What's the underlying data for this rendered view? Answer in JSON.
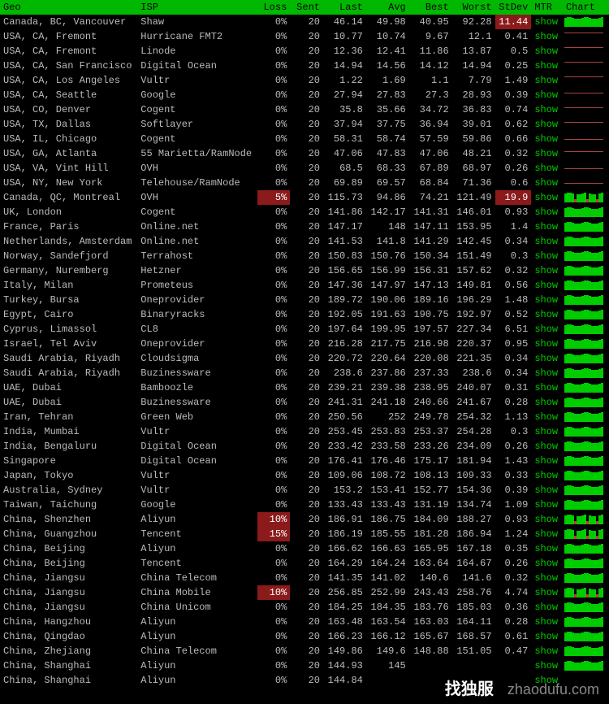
{
  "headers": {
    "geo": "Geo",
    "isp": "ISP",
    "loss": "Loss",
    "sent": "Sent",
    "last": "Last",
    "avg": "Avg",
    "best": "Best",
    "worst": "Worst",
    "stdev": "StDev",
    "mtr": "MTR",
    "chart": "Chart"
  },
  "mtr_label": "show",
  "rows": [
    {
      "geo": "Canada, BC, Vancouver",
      "isp": "Shaw",
      "loss": "0%",
      "sent": "20",
      "last": "46.14",
      "avg": "49.98",
      "best": "40.95",
      "worst": "92.28",
      "stdev": "11.44",
      "stdev_warn": true,
      "chart": "bars"
    },
    {
      "geo": "USA, CA, Fremont",
      "isp": "Hurricane FMT2",
      "loss": "0%",
      "sent": "20",
      "last": "10.77",
      "avg": "10.74",
      "best": "9.67",
      "worst": "12.1",
      "stdev": "0.41",
      "chart": "line-top"
    },
    {
      "geo": "USA, CA, Fremont",
      "isp": "Linode",
      "loss": "0%",
      "sent": "20",
      "last": "12.36",
      "avg": "12.41",
      "best": "11.86",
      "worst": "13.87",
      "stdev": "0.5",
      "chart": "line-top"
    },
    {
      "geo": "USA, CA, San Francisco",
      "isp": "Digital Ocean",
      "loss": "0%",
      "sent": "20",
      "last": "14.94",
      "avg": "14.56",
      "best": "14.12",
      "worst": "14.94",
      "stdev": "0.25",
      "chart": "line-top"
    },
    {
      "geo": "USA, CA, Los Angeles",
      "isp": "Vultr",
      "loss": "0%",
      "sent": "20",
      "last": "1.22",
      "avg": "1.69",
      "best": "1.1",
      "worst": "7.79",
      "stdev": "1.49",
      "chart": "line-top"
    },
    {
      "geo": "USA, CA, Seattle",
      "isp": "Google",
      "loss": "0%",
      "sent": "20",
      "last": "27.94",
      "avg": "27.83",
      "best": "27.3",
      "worst": "28.93",
      "stdev": "0.39",
      "chart": "line-upper"
    },
    {
      "geo": "USA, CO, Denver",
      "isp": "Cogent",
      "loss": "0%",
      "sent": "20",
      "last": "35.8",
      "avg": "35.66",
      "best": "34.72",
      "worst": "36.83",
      "stdev": "0.74",
      "chart": "line-upper"
    },
    {
      "geo": "USA, TX, Dallas",
      "isp": "Softlayer",
      "loss": "0%",
      "sent": "20",
      "last": "37.94",
      "avg": "37.75",
      "best": "36.94",
      "worst": "39.01",
      "stdev": "0.62",
      "chart": "line-upper"
    },
    {
      "geo": "USA, IL, Chicago",
      "isp": "Cogent",
      "loss": "0%",
      "sent": "20",
      "last": "58.31",
      "avg": "58.74",
      "best": "57.59",
      "worst": "59.86",
      "stdev": "0.66",
      "chart": "line-mid"
    },
    {
      "geo": "USA, GA, Atlanta",
      "isp": "55 Marietta/RamNode",
      "loss": "0%",
      "sent": "20",
      "last": "47.06",
      "avg": "47.83",
      "best": "47.06",
      "worst": "48.21",
      "stdev": "0.32",
      "chart": "line-upper"
    },
    {
      "geo": "USA, VA, Vint Hill",
      "isp": "OVH",
      "loss": "0%",
      "sent": "20",
      "last": "68.5",
      "avg": "68.33",
      "best": "67.89",
      "worst": "68.97",
      "stdev": "0.26",
      "chart": "line-mid"
    },
    {
      "geo": "USA, NY, New York",
      "isp": "Telehouse/RamNode",
      "loss": "0%",
      "sent": "20",
      "last": "69.89",
      "avg": "69.57",
      "best": "68.84",
      "worst": "71.36",
      "stdev": "0.6",
      "chart": "line-mid"
    },
    {
      "geo": "Canada, QC, Montreal",
      "isp": "OVH",
      "loss": "5%",
      "loss_warn": true,
      "sent": "20",
      "last": "115.73",
      "avg": "94.86",
      "best": "74.21",
      "worst": "121.49",
      "stdev": "19.9",
      "stdev_warn": true,
      "chart": "bars-loss"
    },
    {
      "geo": "UK, London",
      "isp": "Cogent",
      "loss": "0%",
      "sent": "20",
      "last": "141.86",
      "avg": "142.17",
      "best": "141.31",
      "worst": "146.01",
      "stdev": "0.93",
      "chart": "bars"
    },
    {
      "geo": "France, Paris",
      "isp": "Online.net",
      "loss": "0%",
      "sent": "20",
      "last": "147.17",
      "avg": "148",
      "best": "147.11",
      "worst": "153.95",
      "stdev": "1.4",
      "chart": "bars"
    },
    {
      "geo": "Netherlands, Amsterdam",
      "isp": "Online.net",
      "loss": "0%",
      "sent": "20",
      "last": "141.53",
      "avg": "141.8",
      "best": "141.29",
      "worst": "142.45",
      "stdev": "0.34",
      "chart": "bars"
    },
    {
      "geo": "Norway, Sandefjord",
      "isp": "Terrahost",
      "loss": "0%",
      "sent": "20",
      "last": "150.83",
      "avg": "150.76",
      "best": "150.34",
      "worst": "151.49",
      "stdev": "0.3",
      "chart": "bars"
    },
    {
      "geo": "Germany, Nuremberg",
      "isp": "Hetzner",
      "loss": "0%",
      "sent": "20",
      "last": "156.65",
      "avg": "156.99",
      "best": "156.31",
      "worst": "157.62",
      "stdev": "0.32",
      "chart": "bars"
    },
    {
      "geo": "Italy, Milan",
      "isp": "Prometeus",
      "loss": "0%",
      "sent": "20",
      "last": "147.36",
      "avg": "147.97",
      "best": "147.13",
      "worst": "149.81",
      "stdev": "0.56",
      "chart": "bars"
    },
    {
      "geo": "Turkey, Bursa",
      "isp": "Oneprovider",
      "loss": "0%",
      "sent": "20",
      "last": "189.72",
      "avg": "190.06",
      "best": "189.16",
      "worst": "196.29",
      "stdev": "1.48",
      "chart": "bars"
    },
    {
      "geo": "Egypt, Cairo",
      "isp": "Binaryracks",
      "loss": "0%",
      "sent": "20",
      "last": "192.05",
      "avg": "191.63",
      "best": "190.75",
      "worst": "192.97",
      "stdev": "0.52",
      "chart": "bars"
    },
    {
      "geo": "Cyprus, Limassol",
      "isp": "CL8",
      "loss": "0%",
      "sent": "20",
      "last": "197.64",
      "avg": "199.95",
      "best": "197.57",
      "worst": "227.34",
      "stdev": "6.51",
      "chart": "bars"
    },
    {
      "geo": "Israel, Tel Aviv",
      "isp": "Oneprovider",
      "loss": "0%",
      "sent": "20",
      "last": "216.28",
      "avg": "217.75",
      "best": "216.98",
      "worst": "220.37",
      "stdev": "0.95",
      "chart": "bars"
    },
    {
      "geo": "Saudi Arabia, Riyadh",
      "isp": "Cloudsigma",
      "loss": "0%",
      "sent": "20",
      "last": "220.72",
      "avg": "220.64",
      "best": "220.08",
      "worst": "221.35",
      "stdev": "0.34",
      "chart": "bars"
    },
    {
      "geo": "Saudi Arabia, Riyadh",
      "isp": "Buzinessware",
      "loss": "0%",
      "sent": "20",
      "last": "238.6",
      "avg": "237.86",
      "best": "237.33",
      "worst": "238.6",
      "stdev": "0.34",
      "chart": "bars"
    },
    {
      "geo": "UAE, Dubai",
      "isp": "Bamboozle",
      "loss": "0%",
      "sent": "20",
      "last": "239.21",
      "avg": "239.38",
      "best": "238.95",
      "worst": "240.07",
      "stdev": "0.31",
      "chart": "bars"
    },
    {
      "geo": "UAE, Dubai",
      "isp": "Buzinessware",
      "loss": "0%",
      "sent": "20",
      "last": "241.31",
      "avg": "241.18",
      "best": "240.66",
      "worst": "241.67",
      "stdev": "0.28",
      "chart": "bars"
    },
    {
      "geo": "Iran, Tehran",
      "isp": "Green Web",
      "loss": "0%",
      "sent": "20",
      "last": "250.56",
      "avg": "252",
      "best": "249.78",
      "worst": "254.32",
      "stdev": "1.13",
      "chart": "bars"
    },
    {
      "geo": "India, Mumbai",
      "isp": "Vultr",
      "loss": "0%",
      "sent": "20",
      "last": "253.45",
      "avg": "253.83",
      "best": "253.37",
      "worst": "254.28",
      "stdev": "0.3",
      "chart": "bars"
    },
    {
      "geo": "India, Bengaluru",
      "isp": "Digital Ocean",
      "loss": "0%",
      "sent": "20",
      "last": "233.42",
      "avg": "233.58",
      "best": "233.26",
      "worst": "234.09",
      "stdev": "0.26",
      "chart": "bars"
    },
    {
      "geo": "Singapore",
      "isp": "Digital Ocean",
      "loss": "0%",
      "sent": "20",
      "last": "176.41",
      "avg": "176.46",
      "best": "175.17",
      "worst": "181.94",
      "stdev": "1.43",
      "chart": "bars"
    },
    {
      "geo": "Japan, Tokyo",
      "isp": "Vultr",
      "loss": "0%",
      "sent": "20",
      "last": "109.06",
      "avg": "108.72",
      "best": "108.13",
      "worst": "109.33",
      "stdev": "0.33",
      "chart": "bars"
    },
    {
      "geo": "Australia, Sydney",
      "isp": "Vultr",
      "loss": "0%",
      "sent": "20",
      "last": "153.2",
      "avg": "153.41",
      "best": "152.77",
      "worst": "154.36",
      "stdev": "0.39",
      "chart": "bars"
    },
    {
      "geo": "Taiwan, Taichung",
      "isp": "Google",
      "loss": "0%",
      "sent": "20",
      "last": "133.43",
      "avg": "133.43",
      "best": "131.19",
      "worst": "134.74",
      "stdev": "1.09",
      "chart": "bars"
    },
    {
      "geo": "China, Shenzhen",
      "isp": "Aliyun",
      "loss": "10%",
      "loss_warn": true,
      "sent": "20",
      "last": "186.91",
      "avg": "186.75",
      "best": "184.09",
      "worst": "188.27",
      "stdev": "0.93",
      "chart": "bars-loss"
    },
    {
      "geo": "China, Guangzhou",
      "isp": "Tencent",
      "loss": "15%",
      "loss_warn": true,
      "sent": "20",
      "last": "186.19",
      "avg": "185.55",
      "best": "181.28",
      "worst": "186.94",
      "stdev": "1.24",
      "chart": "bars-loss"
    },
    {
      "geo": "China, Beijing",
      "isp": "Aliyun",
      "loss": "0%",
      "sent": "20",
      "last": "166.62",
      "avg": "166.63",
      "best": "165.95",
      "worst": "167.18",
      "stdev": "0.35",
      "chart": "bars"
    },
    {
      "geo": "China, Beijing",
      "isp": "Tencent",
      "loss": "0%",
      "sent": "20",
      "last": "164.29",
      "avg": "164.24",
      "best": "163.64",
      "worst": "164.67",
      "stdev": "0.26",
      "chart": "bars"
    },
    {
      "geo": "China, Jiangsu",
      "isp": "China Telecom",
      "loss": "0%",
      "sent": "20",
      "last": "141.35",
      "avg": "141.02",
      "best": "140.6",
      "worst": "141.6",
      "stdev": "0.32",
      "chart": "bars"
    },
    {
      "geo": "China, Jiangsu",
      "isp": "China Mobile",
      "loss": "10%",
      "loss_warn": true,
      "sent": "20",
      "last": "256.85",
      "avg": "252.99",
      "best": "243.43",
      "worst": "258.76",
      "stdev": "4.74",
      "chart": "bars-loss"
    },
    {
      "geo": "China, Jiangsu",
      "isp": "China Unicom",
      "loss": "0%",
      "sent": "20",
      "last": "184.25",
      "avg": "184.35",
      "best": "183.76",
      "worst": "185.03",
      "stdev": "0.36",
      "chart": "bars"
    },
    {
      "geo": "China, Hangzhou",
      "isp": "Aliyun",
      "loss": "0%",
      "sent": "20",
      "last": "163.48",
      "avg": "163.54",
      "best": "163.03",
      "worst": "164.11",
      "stdev": "0.28",
      "chart": "bars"
    },
    {
      "geo": "China, Qingdao",
      "isp": "Aliyun",
      "loss": "0%",
      "sent": "20",
      "last": "166.23",
      "avg": "166.12",
      "best": "165.67",
      "worst": "168.57",
      "stdev": "0.61",
      "chart": "bars"
    },
    {
      "geo": "China, Zhejiang",
      "isp": "China Telecom",
      "loss": "0%",
      "sent": "20",
      "last": "149.86",
      "avg": "149.6",
      "best": "148.88",
      "worst": "151.05",
      "stdev": "0.47",
      "chart": "bars"
    },
    {
      "geo": "China, Shanghai",
      "isp": "Aliyun",
      "loss": "0%",
      "sent": "20",
      "last": "144.93",
      "avg": "145",
      "best": "",
      "worst": "",
      "stdev": "",
      "chart": "bars"
    },
    {
      "geo": "China, Shanghai",
      "isp": "Aliyun",
      "loss": "0%",
      "sent": "20",
      "last": "144.84",
      "avg": "",
      "best": "",
      "worst": "",
      "stdev": "",
      "chart": ""
    }
  ],
  "watermark": {
    "cn": "找独服",
    "url": "zhaodufu.com"
  }
}
